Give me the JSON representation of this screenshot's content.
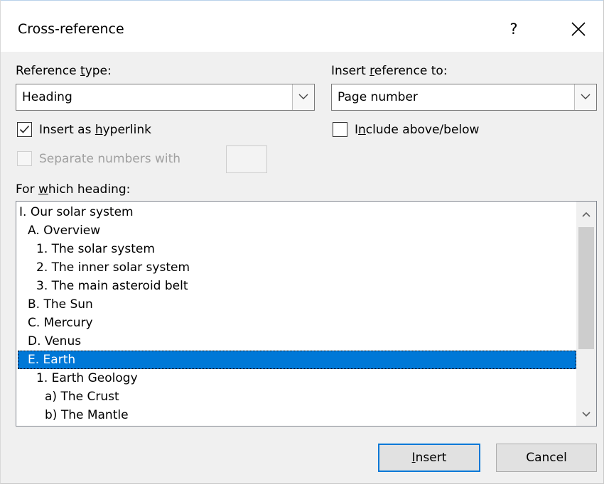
{
  "window": {
    "title": "Cross-reference",
    "help_label": "?"
  },
  "reference_type": {
    "label_pre": "Reference ",
    "label_underlined": "t",
    "label_post": "ype:",
    "value": "Heading"
  },
  "insert_reference_to": {
    "label_pre": "Insert ",
    "label_underlined": "r",
    "label_post": "eference to:",
    "value": "Page number"
  },
  "insert_as_hyperlink": {
    "label_pre": "Insert as ",
    "label_underlined": "h",
    "label_post": "yperlink",
    "checked": true
  },
  "include_above_below": {
    "label_pre": "I",
    "label_underlined": "n",
    "label_post": "clude above/below",
    "checked": false
  },
  "separate_numbers": {
    "label": "Separate numbers with",
    "enabled": false,
    "value": ""
  },
  "heading_list": {
    "label_pre": "For ",
    "label_underlined": "w",
    "label_post": "hich heading:",
    "selected_index": 8,
    "items": [
      {
        "text": "I. Our solar system",
        "indent": 0
      },
      {
        "text": "A. Overview",
        "indent": 1
      },
      {
        "text": "1. The solar system",
        "indent": 2
      },
      {
        "text": "2. The inner solar system",
        "indent": 2
      },
      {
        "text": "3. The main asteroid belt",
        "indent": 2
      },
      {
        "text": "B. The Sun",
        "indent": 1
      },
      {
        "text": "C. Mercury",
        "indent": 1
      },
      {
        "text": "D. Venus",
        "indent": 1
      },
      {
        "text": "E. Earth",
        "indent": 1
      },
      {
        "text": "1. Earth Geology",
        "indent": 2
      },
      {
        "text": "a) The Crust",
        "indent": 3
      },
      {
        "text": "b) The Mantle",
        "indent": 3
      }
    ]
  },
  "buttons": {
    "insert_underlined": "I",
    "insert_post": "nsert",
    "cancel": "Cancel"
  },
  "colors": {
    "selection": "#0078d7",
    "default_button_border": "#0078d7"
  }
}
